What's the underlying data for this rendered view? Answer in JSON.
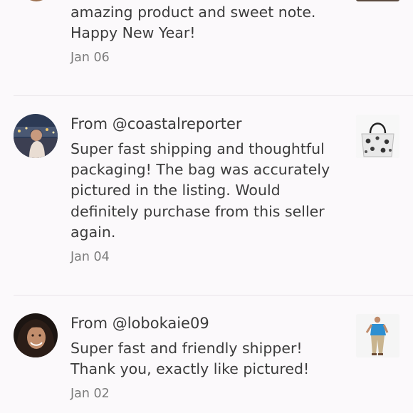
{
  "reviews": [
    {
      "text_lines": [
        "amazing product and sweet note.",
        "Happy New Year!"
      ],
      "date": "Jan 06"
    },
    {
      "from": "From @coastalreporter",
      "text_lines": [
        "Super fast shipping and thoughtful",
        "packaging! The bag was accurately",
        "pictured in the listing. Would",
        "definitely purchase from this seller",
        "again."
      ],
      "date": "Jan 04"
    },
    {
      "from": "From @lobokaie09",
      "text_lines": [
        "Super fast and friendly shipper!",
        "Thank you, exactly like pictured!"
      ],
      "date": "Jan 02"
    }
  ]
}
